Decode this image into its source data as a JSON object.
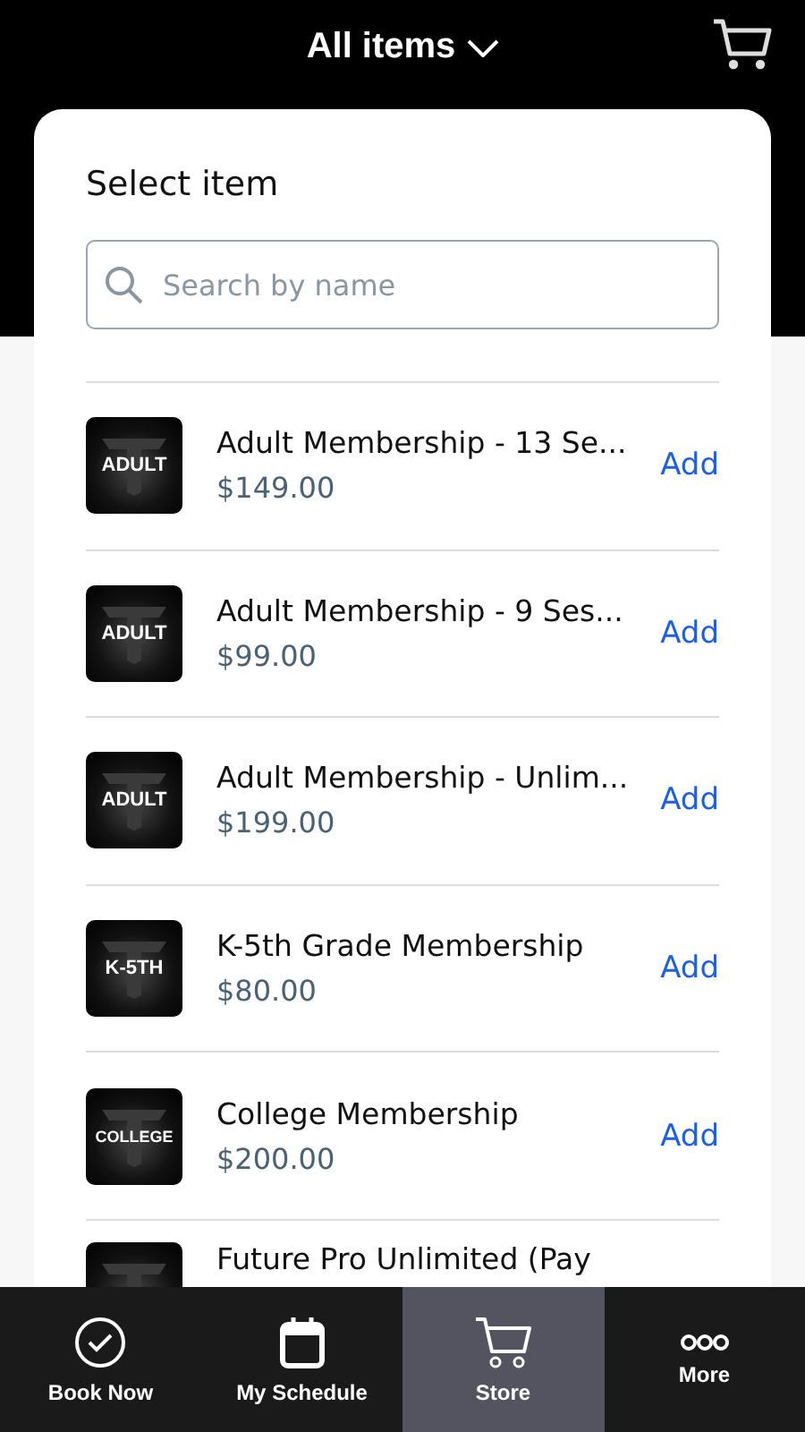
{
  "header": {
    "title": "All items"
  },
  "card": {
    "title": "Select item",
    "search": {
      "placeholder": "Search by name"
    },
    "items": [
      {
        "badge": "ADULT",
        "name": "Adult Membership - 13 Se...",
        "price": "$149.00",
        "action": "Add"
      },
      {
        "badge": "ADULT",
        "name": "Adult Membership - 9 Ses...",
        "price": "$99.00",
        "action": "Add"
      },
      {
        "badge": "ADULT",
        "name": "Adult Membership - Unlim...",
        "price": "$199.00",
        "action": "Add"
      },
      {
        "badge": "K-5TH",
        "name": "K-5th Grade Membership",
        "price": "$80.00",
        "action": "Add"
      },
      {
        "badge": "COLLEGE",
        "name": "College Membership",
        "price": "$200.00",
        "action": "Add"
      },
      {
        "name": "Future Pro Unlimited (Pay"
      }
    ]
  },
  "tabs": [
    {
      "kind": "check",
      "label": "Book Now",
      "selected": false
    },
    {
      "kind": "calendar",
      "label": "My Schedule",
      "selected": false
    },
    {
      "kind": "cart",
      "label": "Store",
      "selected": true
    },
    {
      "kind": "dots",
      "label": "More",
      "selected": false
    }
  ]
}
